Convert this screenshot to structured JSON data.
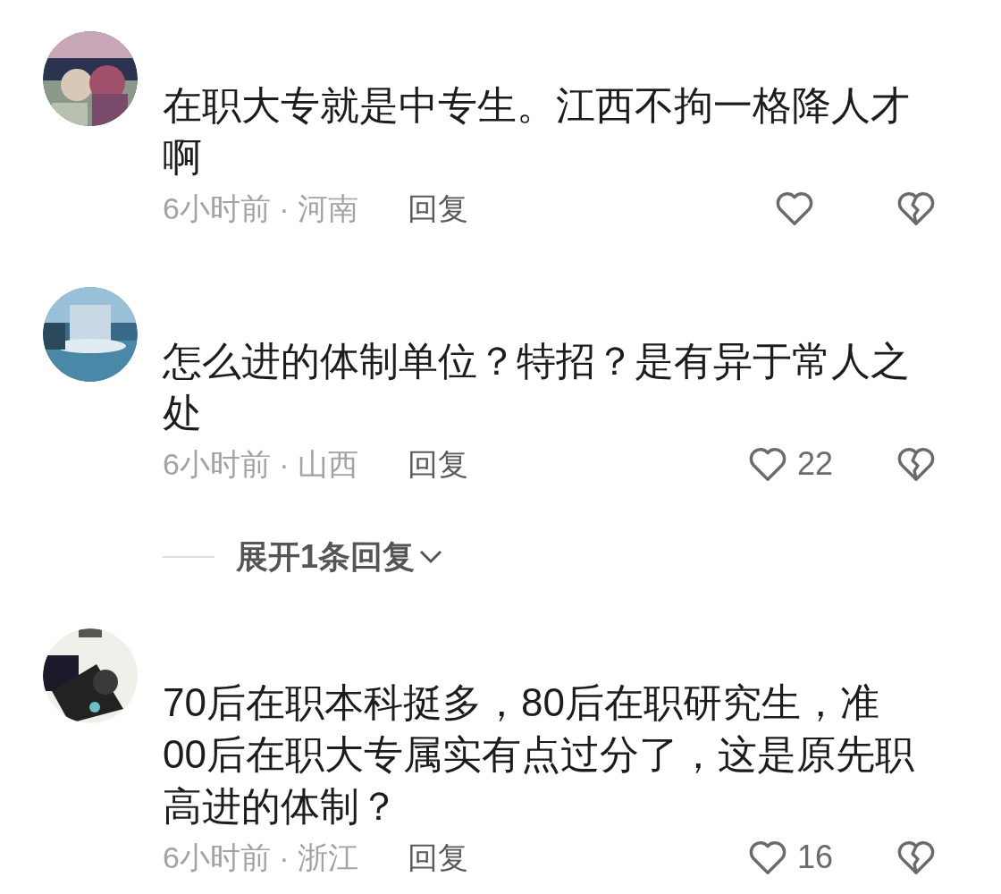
{
  "comments": [
    {
      "avatar": {
        "kind": "picture"
      },
      "lines": [
        "在职大专就是中专生。江西不拘一格降人才",
        "啊"
      ],
      "meta": "6小时前 · 河南",
      "reply": "回复"
    },
    {
      "avatar": {
        "kind": "picture"
      },
      "lines": [
        "怎么进的体制单位？特招？是有异于常人之",
        "处"
      ],
      "meta": "6小时前 · 山西",
      "reply": "回复",
      "likes": "22",
      "expand": "展开1条回复"
    },
    {
      "avatar": {
        "kind": "picture"
      },
      "lines": [
        "70后在职本科挺多，80后在职研究生，准",
        "00后在职大专属实有点过分了，这是原先职",
        "高进的体制？"
      ],
      "meta": "6小时前 · 浙江",
      "reply": "回复",
      "likes": "16"
    }
  ]
}
